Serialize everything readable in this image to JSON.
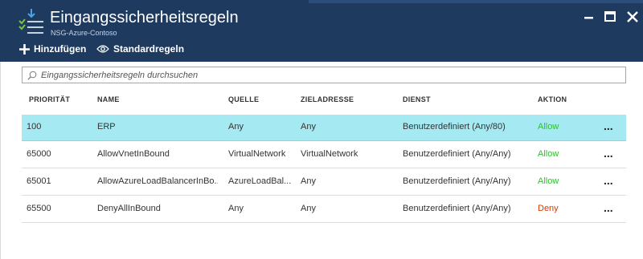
{
  "header": {
    "title": "Eingangssicherheitsregeln",
    "subtitle": "NSG-Azure-Contoso",
    "commands": {
      "add_label": "Hinzufügen",
      "defaults_label": "Standardregeln"
    },
    "icons": {
      "blade": "inbound-rules-icon",
      "add": "plus-icon",
      "defaults": "eye-icon",
      "minimize": "minimize-icon",
      "maximize": "maximize-icon",
      "close": "close-icon"
    },
    "background_color": "#1e3a5f"
  },
  "search": {
    "placeholder": "Eingangssicherheitsregeln durchsuchen",
    "value": ""
  },
  "table": {
    "columns": [
      "PRIORITÄT",
      "NAME",
      "QUELLE",
      "ZIELADRESSE",
      "DIENST",
      "AKTION"
    ],
    "rows": [
      {
        "priority": "100",
        "name": "ERP",
        "source": "Any",
        "destination": "Any",
        "service": "Benutzerdefiniert (Any/80)",
        "action": "Allow",
        "selected": true
      },
      {
        "priority": "65000",
        "name": "AllowVnetInBound",
        "source": "VirtualNetwork",
        "destination": "VirtualNetwork",
        "service": "Benutzerdefiniert (Any/Any)",
        "action": "Allow",
        "selected": false
      },
      {
        "priority": "65001",
        "name": "AllowAzureLoadBalancerInBo...",
        "source": "AzureLoadBal...",
        "destination": "Any",
        "service": "Benutzerdefiniert (Any/Any)",
        "action": "Allow",
        "selected": false
      },
      {
        "priority": "65500",
        "name": "DenyAllInBound",
        "source": "Any",
        "destination": "Any",
        "service": "Benutzerdefiniert (Any/Any)",
        "action": "Deny",
        "selected": false
      }
    ],
    "more_label": "...",
    "colors": {
      "selected_row": "#a5eaf2",
      "allow": "#2ec02e",
      "deny": "#d83b01"
    }
  }
}
